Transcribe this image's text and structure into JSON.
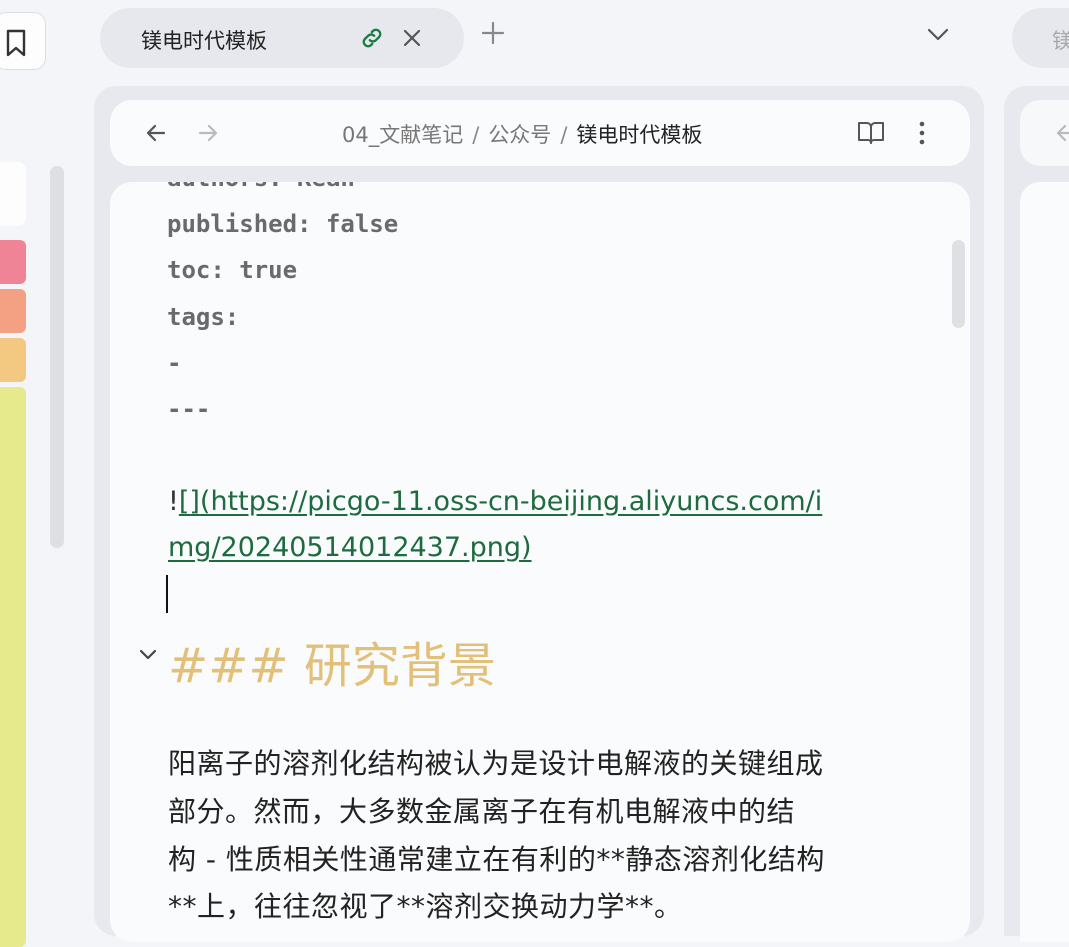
{
  "tab": {
    "title": "镁电时代模板",
    "right_partial_title": "镁"
  },
  "nav": {
    "breadcrumb": [
      "04_文献笔记",
      "公众号",
      "镁电时代模板"
    ],
    "separator": "/"
  },
  "frontmatter": {
    "authors_partial": "authors: Kean",
    "published": "published: false",
    "toc": "toc: true",
    "tags": "tags:",
    "dash": "-",
    "divider": "---"
  },
  "image_link": {
    "bang": "!",
    "bracket": "[]",
    "line1": "(https://picgo-11.oss-cn-beijing.aliyuncs.com/i",
    "line2": "mg/20240514012437.png)"
  },
  "heading": "### 研究背景",
  "paragraph": {
    "line1": "阳离子的溶剂化结构被认为是设计电解液的关键组成",
    "line2": "部分。然而，大多数金属离子在有机电解液中的结",
    "line3": "构 - 性质相关性通常建立在有利的**静态溶剂化结构",
    "line4": "**上，往往忽视了**溶剂交换动力学**。"
  },
  "colors": {
    "heading": "#e3c07a",
    "link": "#1d6b3e",
    "swatch_pink": "#f08497",
    "swatch_salmon": "#f4a083",
    "swatch_orange": "#f3c982",
    "swatch_yellow": "#e6ea8d"
  }
}
